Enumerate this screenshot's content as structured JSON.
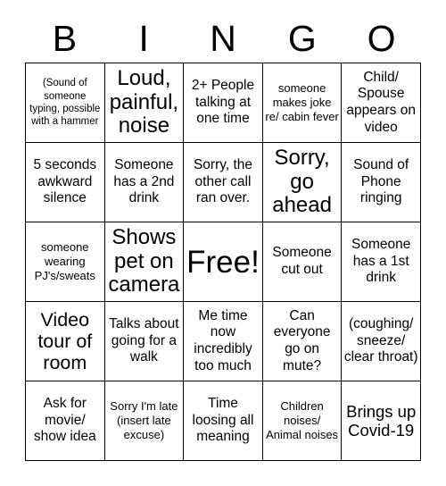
{
  "card": {
    "title": "BINGO",
    "background_color": "#ffffff",
    "text_color": "#000000",
    "border_color": "#000000",
    "grid_size": "5x5"
  },
  "header": {
    "letters": [
      "B",
      "I",
      "N",
      "G",
      "O"
    ]
  },
  "grid": {
    "columns": 5,
    "rows": 5,
    "cells": [
      {
        "text": "(Sound of someone typing, possible with a hammer",
        "size": "fs-xs",
        "column": "B",
        "row": 1
      },
      {
        "text": "Loud, painful, noise",
        "size": "fs-xxl",
        "column": "I",
        "row": 1
      },
      {
        "text": "2+ People talking at one time",
        "size": "fs-md",
        "column": "N",
        "row": 1
      },
      {
        "text": "someone makes joke re/ cabin fever",
        "size": "fs-sm",
        "column": "G",
        "row": 1
      },
      {
        "text": "Child/ Spouse appears on video",
        "size": "fs-md",
        "column": "O",
        "row": 1
      },
      {
        "text": "5 seconds awkward silence",
        "size": "fs-md",
        "column": "B",
        "row": 2
      },
      {
        "text": "Someone has a 2nd drink",
        "size": "fs-md",
        "column": "I",
        "row": 2
      },
      {
        "text": "Sorry, the other call ran over.",
        "size": "fs-md",
        "column": "N",
        "row": 2
      },
      {
        "text": "Sorry, go ahead",
        "size": "fs-xxl",
        "column": "G",
        "row": 2
      },
      {
        "text": "Sound of Phone ringing",
        "size": "fs-md",
        "column": "O",
        "row": 2
      },
      {
        "text": "someone wearing PJ's/sweats",
        "size": "fs-sm",
        "column": "B",
        "row": 3
      },
      {
        "text": "Shows pet on camera",
        "size": "fs-xxl",
        "column": "I",
        "row": 3
      },
      {
        "text": "Free!",
        "size": "fs-free",
        "column": "N",
        "row": 3
      },
      {
        "text": "Someone cut out",
        "size": "fs-md",
        "column": "G",
        "row": 3
      },
      {
        "text": "Someone has a 1st drink",
        "size": "fs-md",
        "column": "O",
        "row": 3
      },
      {
        "text": "Video tour of room",
        "size": "fs-xl",
        "column": "B",
        "row": 4
      },
      {
        "text": "Talks about going for a walk",
        "size": "fs-md",
        "column": "I",
        "row": 4
      },
      {
        "text": "Me time now incredibly too much",
        "size": "fs-md",
        "column": "N",
        "row": 4
      },
      {
        "text": "Can everyone go on mute?",
        "size": "fs-md",
        "column": "G",
        "row": 4
      },
      {
        "text": "(coughing/ sneeze/ clear throat)",
        "size": "fs-md",
        "column": "O",
        "row": 4
      },
      {
        "text": "Ask for movie/ show idea",
        "size": "fs-md",
        "column": "B",
        "row": 5
      },
      {
        "text": "Sorry I'm late (insert late excuse)",
        "size": "fs-sm",
        "column": "I",
        "row": 5
      },
      {
        "text": "Time loosing all meaning",
        "size": "fs-md",
        "column": "N",
        "row": 5
      },
      {
        "text": "Children noises/ Animal noises",
        "size": "fs-sm",
        "column": "G",
        "row": 5
      },
      {
        "text": "Brings up Covid-19",
        "size": "fs-lg",
        "column": "O",
        "row": 5
      }
    ]
  }
}
